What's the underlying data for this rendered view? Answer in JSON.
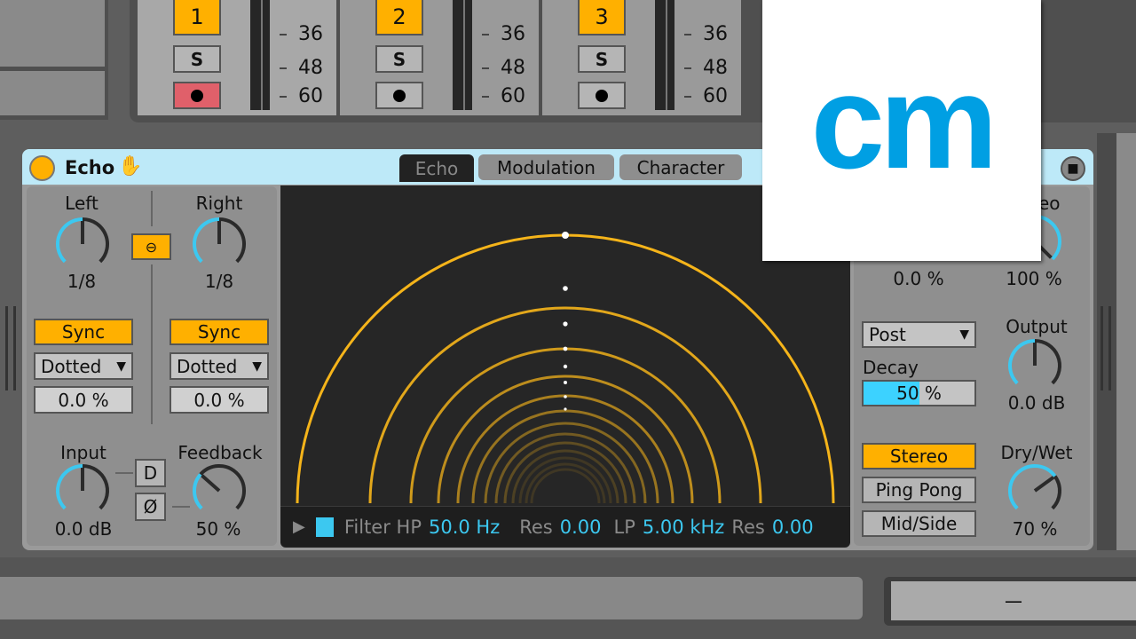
{
  "tracks": [
    {
      "number": "1",
      "solo": "S",
      "arm_icon": "clock-icon",
      "arm_color": "#e0606a",
      "scale": [
        "36",
        "48",
        "60"
      ]
    },
    {
      "number": "2",
      "solo": "S",
      "arm_icon": "record-dot-icon",
      "arm_color": "#b5b5b5",
      "scale": [
        "36",
        "48",
        "60"
      ]
    },
    {
      "number": "3",
      "solo": "S",
      "arm_icon": "record-dot-icon",
      "arm_color": "#b5b5b5",
      "scale": [
        "36",
        "48",
        "60"
      ]
    }
  ],
  "device": {
    "title": "Echo",
    "hand_icon": "hand-icon",
    "tabs": [
      "Echo",
      "Modulation",
      "Character"
    ],
    "active_tab": "Echo"
  },
  "left": {
    "label": "Left",
    "value": "1/8",
    "sync": "Sync",
    "mode": "Dotted",
    "offset": "0.0 %"
  },
  "right": {
    "label": "Right",
    "value": "1/8",
    "sync": "Sync",
    "mode": "Dotted",
    "offset": "0.0 %"
  },
  "input": {
    "label": "Input",
    "value": "0.0 dB"
  },
  "feedback": {
    "label": "Feedback",
    "value": "50 %"
  },
  "d_button": "D",
  "phase_button": "Ø",
  "filter": {
    "label": "Filter HP",
    "hp": "50.0 Hz",
    "res1_label": "Res",
    "res1": "0.00",
    "lp_label": "LP",
    "lp": "5.00 kHz",
    "res2_label": "Res",
    "res2": "0.00"
  },
  "rightpanel": {
    "knob1_value": "0.0 %",
    "stereo_label": "eo",
    "stereo_value": "100 %",
    "post": "Post",
    "decay_label": "Decay",
    "decay": "50 %",
    "decay_fraction": 0.5,
    "output_label": "Output",
    "output": "0.0 dB",
    "modes": [
      "Stereo",
      "Ping Pong",
      "Mid/Side"
    ],
    "active_mode": "Stereo",
    "drywet_label": "Dry/Wet",
    "drywet": "70 %"
  },
  "logo": {
    "text": "cm",
    "color": "#009fe3"
  },
  "bottom": {
    "field": "—"
  },
  "colors": {
    "accent": "#ffb000",
    "blue": "#3cc8f0",
    "header": "#bde9f8"
  }
}
